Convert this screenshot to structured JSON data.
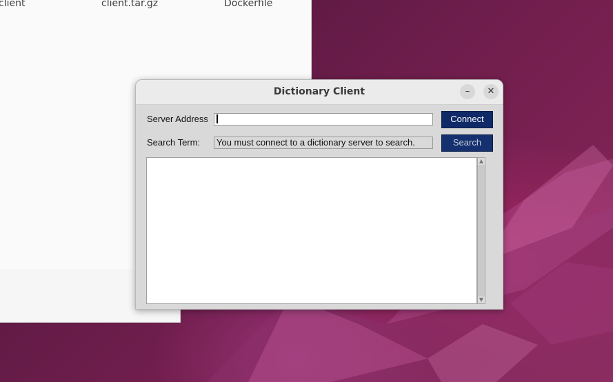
{
  "file_manager": {
    "files": [
      "client",
      "client.tar.gz",
      "Dockerfile"
    ]
  },
  "dialog": {
    "title": "Dictionary Client",
    "minimize_icon": "minimize-icon",
    "close_icon": "close-icon",
    "server_label": "Server Address:",
    "server_value": "",
    "term_label": "Search Term:",
    "term_value": "You must connect to a dictionary server to search.",
    "connect_label": "Connect",
    "search_label": "Search",
    "results_text": ""
  },
  "colors": {
    "button_bg": "#0f2a66",
    "dialog_bg": "#d9d9d9",
    "wallpaper": "#6b1d4a"
  }
}
